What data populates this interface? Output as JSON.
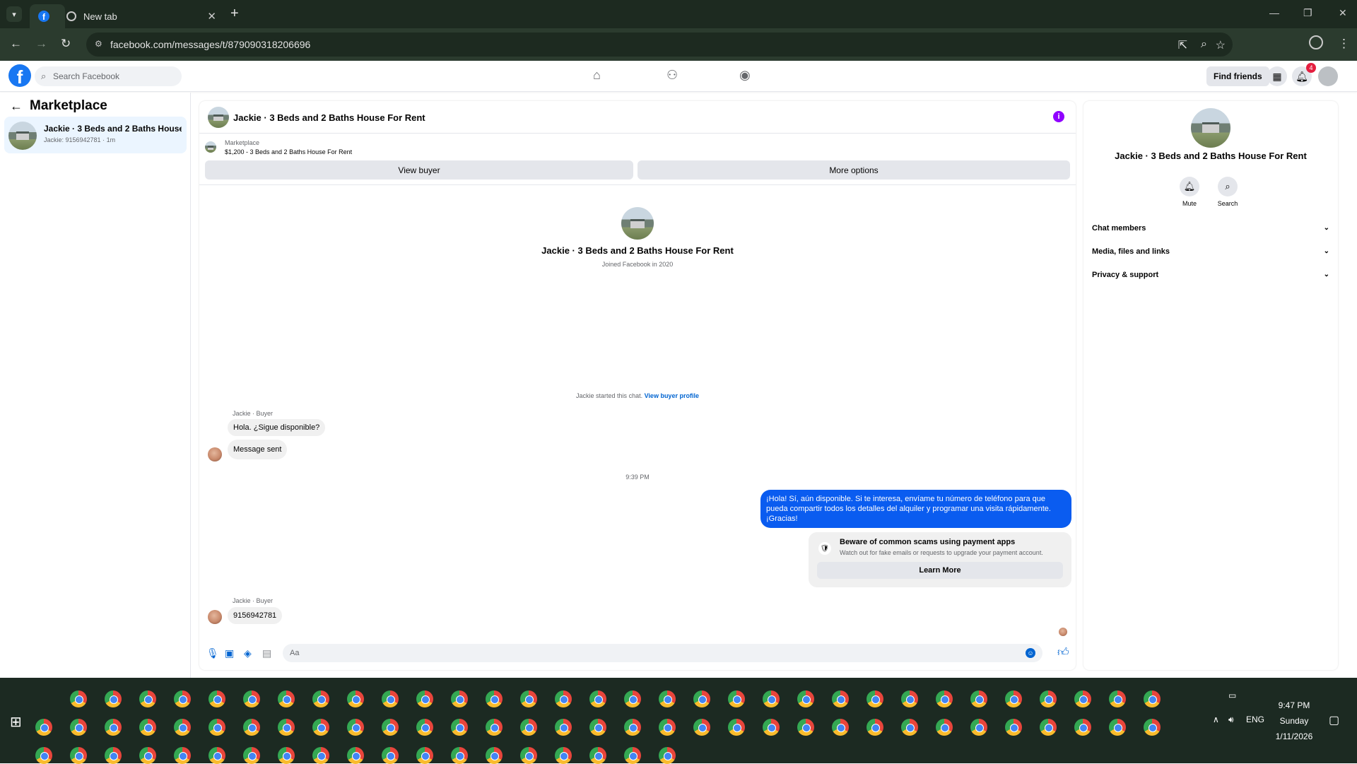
{
  "browser": {
    "tab_active_icon": "facebook-icon",
    "tab_new_label": "New tab",
    "url": "facebook.com/messages/t/879090318206696"
  },
  "fb": {
    "search_placeholder": "Search Facebook",
    "find_friends_label": "Find friends",
    "notifications_count": "4"
  },
  "sidebar": {
    "title": "Marketplace",
    "conversation": {
      "name": "Jackie · 3 Beds and 2 Baths House ...",
      "sub": "Jackie: 9156942781 · 1m"
    }
  },
  "chat": {
    "title": "Jackie · 3 Beds and 2 Baths House For Rent",
    "listing_source": "Marketplace",
    "listing_price": "$1,200 - 3 Beds and 2 Baths House For Rent",
    "view_buyer_label": "View buyer",
    "more_options_label": "More options",
    "profile_name": "Jackie · 3 Beds and 2 Baths House For Rent",
    "profile_joined": "Joined Facebook in 2020",
    "started_text": "Jackie started this chat.",
    "started_link": "View buyer profile",
    "messages": [
      {
        "sender": "Jackie · Buyer",
        "text": "Hola. ¿Sigue disponible?"
      },
      {
        "text": "Message sent"
      },
      {
        "sender": "Jackie · Buyer",
        "text": "9156942781"
      }
    ],
    "time_separator": "9:39 PM",
    "outgoing_message": "¡Hola! Sí, aún disponible. Si te interesa, envíame tu número de teléfono para que pueda compartir todos los detalles del alquiler y programar una visita rápidamente. ¡Gracias!",
    "scam_title": "Beware of common scams using payment apps",
    "scam_desc": "Watch out for fake emails or requests to upgrade your payment account.",
    "learn_more_label": "Learn More",
    "composer_placeholder": "Aa"
  },
  "details": {
    "name": "Jackie · 3 Beds and 2 Baths House For Rent",
    "mute_label": "Mute",
    "search_label": "Search",
    "sections": [
      "Chat members",
      "Media, files and links",
      "Privacy & support"
    ]
  },
  "taskbar": {
    "lang": "ENG",
    "time": "9:47 PM",
    "day": "Sunday",
    "date": "1/11/2026"
  },
  "colors": {
    "fb_blue": "#1877f2",
    "outgoing_bubble": "#0a5cf0",
    "info_purple": "#9000ff",
    "chrome_frame": "#1d2a20"
  }
}
